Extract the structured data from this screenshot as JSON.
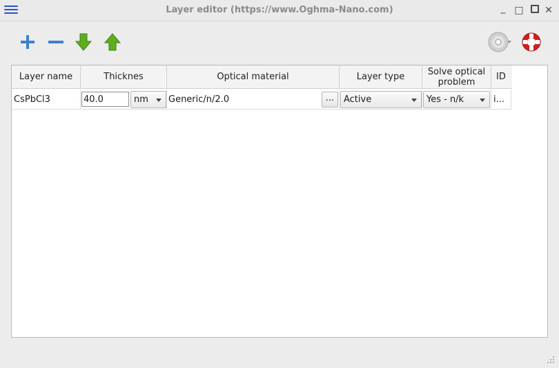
{
  "window": {
    "title": "Layer editor (https://www.Oghma-Nano.com)",
    "controls": {
      "minimize": "_",
      "restore": "□",
      "close": "✕"
    }
  },
  "toolbar": {
    "buttons": [
      {
        "name": "add-layer",
        "icon": "plus-icon"
      },
      {
        "name": "remove-layer",
        "icon": "minus-icon"
      },
      {
        "name": "move-down",
        "icon": "arrow-down-icon"
      },
      {
        "name": "move-up",
        "icon": "arrow-up-icon"
      }
    ],
    "right_icons": [
      "disc-icon",
      "help-lifebuoy-icon"
    ]
  },
  "table": {
    "headers": {
      "layer_name": "Layer name",
      "thickness": "Thicknes",
      "optical_material": "Optical material",
      "layer_type": "Layer type",
      "solve_optical_line1": "Solve optical",
      "solve_optical_line2": "problem",
      "id": "ID"
    },
    "rows": [
      {
        "layer_name": "CsPbCl3",
        "thickness": "40.0",
        "unit": "nm",
        "optical_material": "Generic/n/2.0",
        "browse": "...",
        "layer_type": "Active",
        "solve_optical": "Yes - n/k",
        "id": "i..."
      }
    ]
  },
  "colors": {
    "accent": "#2e4fc9",
    "arrow_green": "#5fae1e",
    "plus_blue": "#3d7fd1",
    "help_red": "#d21f1f"
  }
}
